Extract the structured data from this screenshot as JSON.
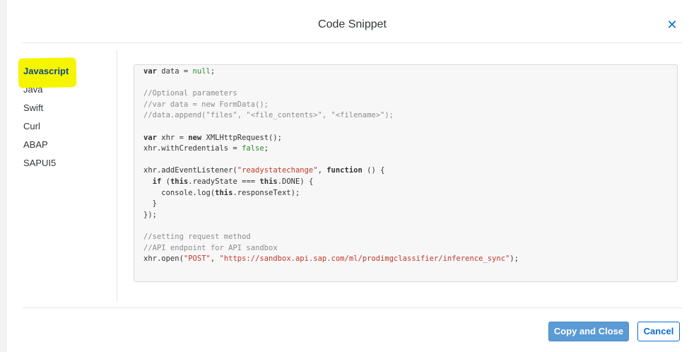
{
  "dialog": {
    "title": "Code Snippet",
    "close_icon": "close-icon",
    "close_glyph": "✕"
  },
  "languages": {
    "items": [
      {
        "label": "Javascript",
        "active": true
      },
      {
        "label": "Java",
        "active": false
      },
      {
        "label": "Swift",
        "active": false
      },
      {
        "label": "Curl",
        "active": false
      },
      {
        "label": "ABAP",
        "active": false
      },
      {
        "label": "SAPUI5",
        "active": false
      }
    ],
    "highlight_color": "#f6f500"
  },
  "code": {
    "lines": [
      "var data = null;",
      "",
      "//Optional parameters",
      "//var data = new FormData();",
      "//data.append(\"files\", \"<file_contents>\", \"<filename>\");",
      "",
      "var xhr = new XMLHttpRequest();",
      "xhr.withCredentials = false;",
      "",
      "xhr.addEventListener(\"readystatechange\", function () {",
      "  if (this.readyState === this.DONE) {",
      "    console.log(this.responseText);",
      "  }",
      "});",
      "",
      "//setting request method",
      "//API endpoint for API sandbox",
      "xhr.open(\"POST\", \"https://sandbox.api.sap.com/ml/prodimgclassifier/inference_sync\");"
    ]
  },
  "footer": {
    "primary_label": "Copy and Close",
    "secondary_label": "Cancel"
  },
  "colors": {
    "accent": "#0a6ed1",
    "primary_button": "#5b9bd5"
  }
}
